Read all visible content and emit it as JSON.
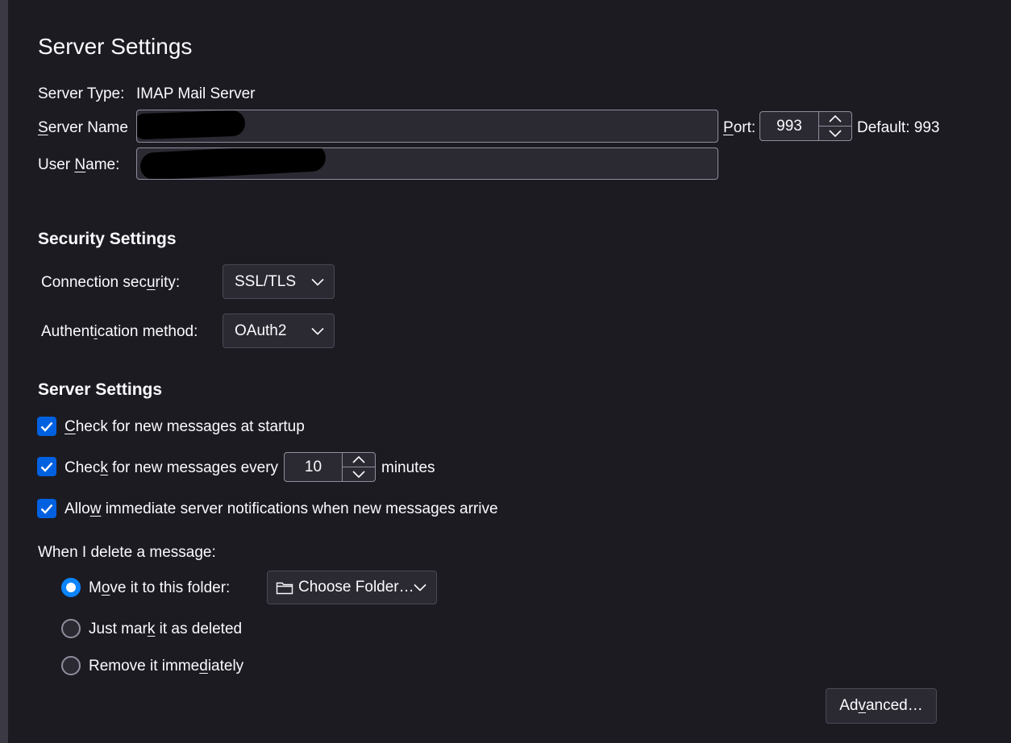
{
  "page": {
    "title": "Server Settings"
  },
  "server": {
    "type_label": "Server Type:",
    "type_value": "IMAP Mail Server",
    "name_label_pre": "",
    "name_label_key": "S",
    "name_label_post": "erver Name",
    "port_label_pre": "",
    "port_label_key": "P",
    "port_label_post": "ort:",
    "port_value": "993",
    "default_port": "Default: 993",
    "user_label_pre": "User ",
    "user_label_key": "N",
    "user_label_post": "ame:"
  },
  "security": {
    "title": "Security Settings",
    "connection_label_pre": "Connection sec",
    "connection_label_key": "u",
    "connection_label_post": "rity:",
    "connection_value": "SSL/TLS",
    "auth_label_pre": "Authent",
    "auth_label_key": "i",
    "auth_label_post": "cation method:",
    "auth_value": "OAuth2"
  },
  "settings": {
    "title": "Server Settings",
    "check_startup_key": "C",
    "check_startup_post": "heck for new messages at startup",
    "check_every_pre": "Chec",
    "check_every_key": "k",
    "check_every_post": " for new messages every",
    "check_every_value": "10",
    "minutes_label": "minutes",
    "allow_pre": "Allo",
    "allow_key": "w",
    "allow_post": " immediate server notifications when new messages arrive"
  },
  "delete": {
    "label": "When I delete a message:",
    "move_pre": "M",
    "move_key": "o",
    "move_post": "ve it to this folder:",
    "folder_value": "Choose Folder…",
    "mark_pre": "Just mar",
    "mark_key": "k",
    "mark_post": " it as deleted",
    "remove_pre": "Remove it imme",
    "remove_key": "d",
    "remove_post": "iately"
  },
  "advanced": {
    "label_pre": "Ad",
    "label_key": "v",
    "label_post": "anced…"
  },
  "colors": {
    "background": "#1c1b22",
    "accent": "#0061e0",
    "field": "#2b2a33"
  }
}
